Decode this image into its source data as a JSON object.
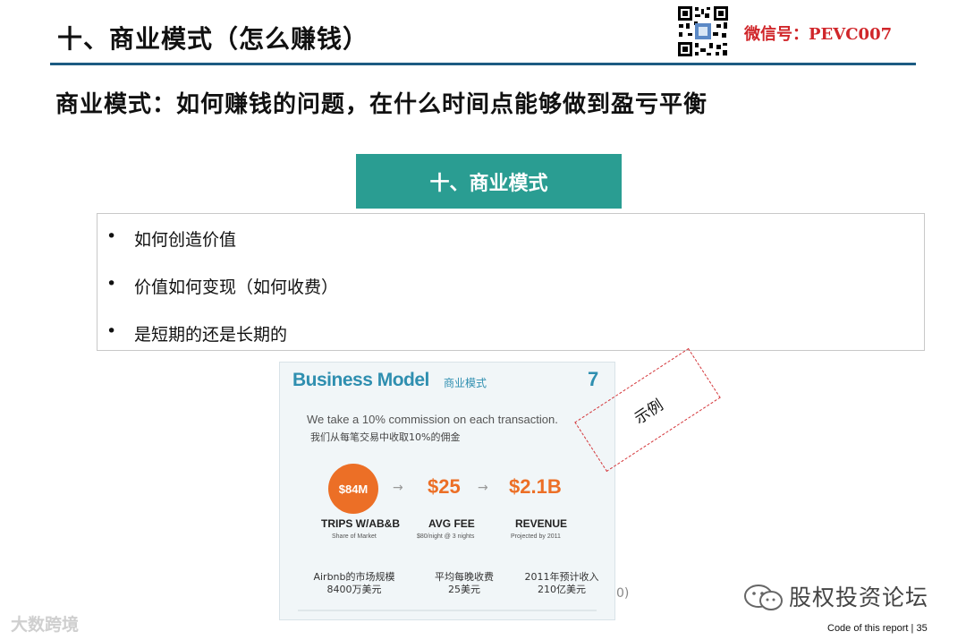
{
  "header": {
    "title": "十、商业模式（怎么赚钱）",
    "wechat_label": "微信号：PEVC007",
    "qr_icon": "qr-code-icon"
  },
  "subtitle": "商业模式：如何赚钱的问题，在什么时间点能够做到盈亏平衡",
  "section": {
    "tab_label": "十、商业模式",
    "bullets": [
      "如何创造价值",
      "价值如何变现（如何收费）",
      "是短期的还是长期的"
    ],
    "bullet_glyph": "•"
  },
  "example_slide": {
    "title": "Business Model",
    "title_cn": "商业模式",
    "page": "7",
    "line_en": "We take a 10% commission on each transaction.",
    "line_cn": "我们从每笔交易中收取10%的佣金",
    "metrics": [
      {
        "value": "$84M",
        "caption": "TRIPS W/AB&B",
        "sub": "Share of Market",
        "cn1": "Airbnb的市场规模",
        "cn2": "8400万美元"
      },
      {
        "value": "$25",
        "caption": "AVG FEE",
        "sub": "$80/night @ 3 nights",
        "cn1": "平均每晚收费",
        "cn2": "25美元"
      },
      {
        "value": "$2.1B",
        "caption": "REVENUE",
        "sub": "Projected by 2011",
        "cn1": "2011年预计收入",
        "cn2": "210亿美元"
      }
    ],
    "arrow": "→"
  },
  "stamp_label": "示例",
  "paren_fragment": "0)",
  "forum_label": "股权投资论坛",
  "watermark": "大数跨境",
  "footer": "Code of this report   | 35"
}
